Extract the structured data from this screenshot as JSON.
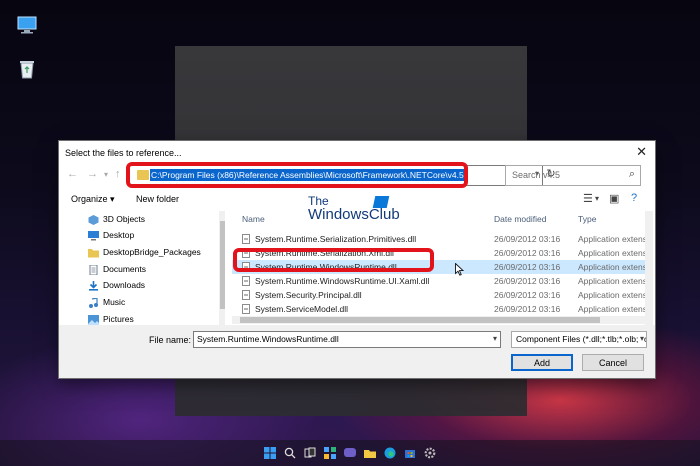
{
  "dialog": {
    "title": "Select the files to reference...",
    "close_glyph": "✕",
    "address": {
      "path": "C:\\Program Files (x86)\\Reference Assemblies\\Microsoft\\Framework\\.NETCore\\v4.5"
    },
    "search_placeholder": "Search v4.5",
    "toolbar": {
      "organize_label": "Organize ▾",
      "new_folder_label": "New folder"
    },
    "nav_items": [
      {
        "label": "3D Objects",
        "icon": "cube-icon",
        "color": "#5a9bd8"
      },
      {
        "label": "Desktop",
        "icon": "desktop-icon",
        "color": "#2a7fd4"
      },
      {
        "label": "DesktopBridge_Packages",
        "icon": "folder-icon",
        "color": "#e9c553"
      },
      {
        "label": "Documents",
        "icon": "documents-icon",
        "color": "#6e7c8c"
      },
      {
        "label": "Downloads",
        "icon": "download-icon",
        "color": "#1a73c8"
      },
      {
        "label": "Music",
        "icon": "music-icon",
        "color": "#3a7fc6"
      },
      {
        "label": "Pictures",
        "icon": "pictures-icon",
        "color": "#4b94d6"
      }
    ],
    "columns": {
      "name": "Name",
      "date": "Date modified",
      "type": "Type"
    },
    "files": [
      {
        "name": "System.Runtime.Serialization.Primitives.dll",
        "date": "26/09/2012 03:16",
        "type": "Application extension"
      },
      {
        "name": "System.Runtime.Serialization.Xml.dll",
        "date": "26/09/2012 03:16",
        "type": "Application extension"
      },
      {
        "name": "System.Runtime.WindowsRuntime.dll",
        "date": "26/09/2012 03:16",
        "type": "Application extension"
      },
      {
        "name": "System.Runtime.WindowsRuntime.UI.Xaml.dll",
        "date": "26/09/2012 03:16",
        "type": "Application extension"
      },
      {
        "name": "System.Security.Principal.dll",
        "date": "26/09/2012 03:16",
        "type": "Application extension"
      },
      {
        "name": "System.ServiceModel.dll",
        "date": "26/09/2012 03:16",
        "type": "Application extension"
      }
    ],
    "selected_index": 2,
    "file_name_label": "File name:",
    "file_name_value": "System.Runtime.WindowsRuntime.dll",
    "filter_value": "Component Files (*.dll;*.tlb;*.olb;*.ocx;*.exe;*.manifest)",
    "open_label": "Add",
    "cancel_label": "Cancel"
  },
  "watermark": {
    "line1": "The",
    "line2": "WindowsClub"
  },
  "colors": {
    "accent": "#0a66cc",
    "highlight_border": "#e3131b",
    "selection": "#cce8ff"
  }
}
